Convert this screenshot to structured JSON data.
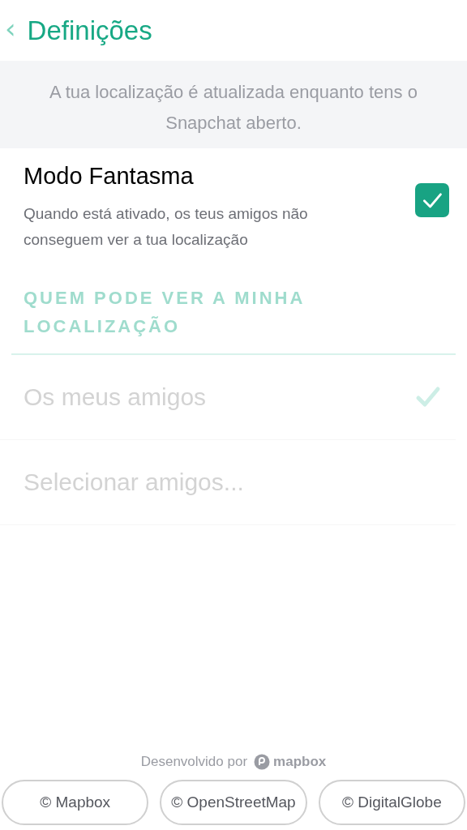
{
  "header": {
    "back_icon": "‹",
    "title": "Definições"
  },
  "banner": "A tua localização é atualizada enquanto tens o Snapchat aberto.",
  "ghost_mode": {
    "label": "Modo Fantasma",
    "description": "Quando está ativado, os teus amigos não conseguem ver a tua localização",
    "checked": true
  },
  "section": {
    "title": "QUEM PODE VER A MINHA LOCALIZAÇÃO",
    "disabled": true
  },
  "options": [
    {
      "label": "Os meus amigos",
      "selected": true,
      "disabled": true
    },
    {
      "label": "Selecionar amigos...",
      "selected": false,
      "disabled": true
    }
  ],
  "footer": {
    "powered_by": "Desenvolvido por",
    "logo_text": "mapbox",
    "buttons": [
      "© Mapbox",
      "© OpenStreetMap",
      "© DigitalGlobe"
    ]
  }
}
